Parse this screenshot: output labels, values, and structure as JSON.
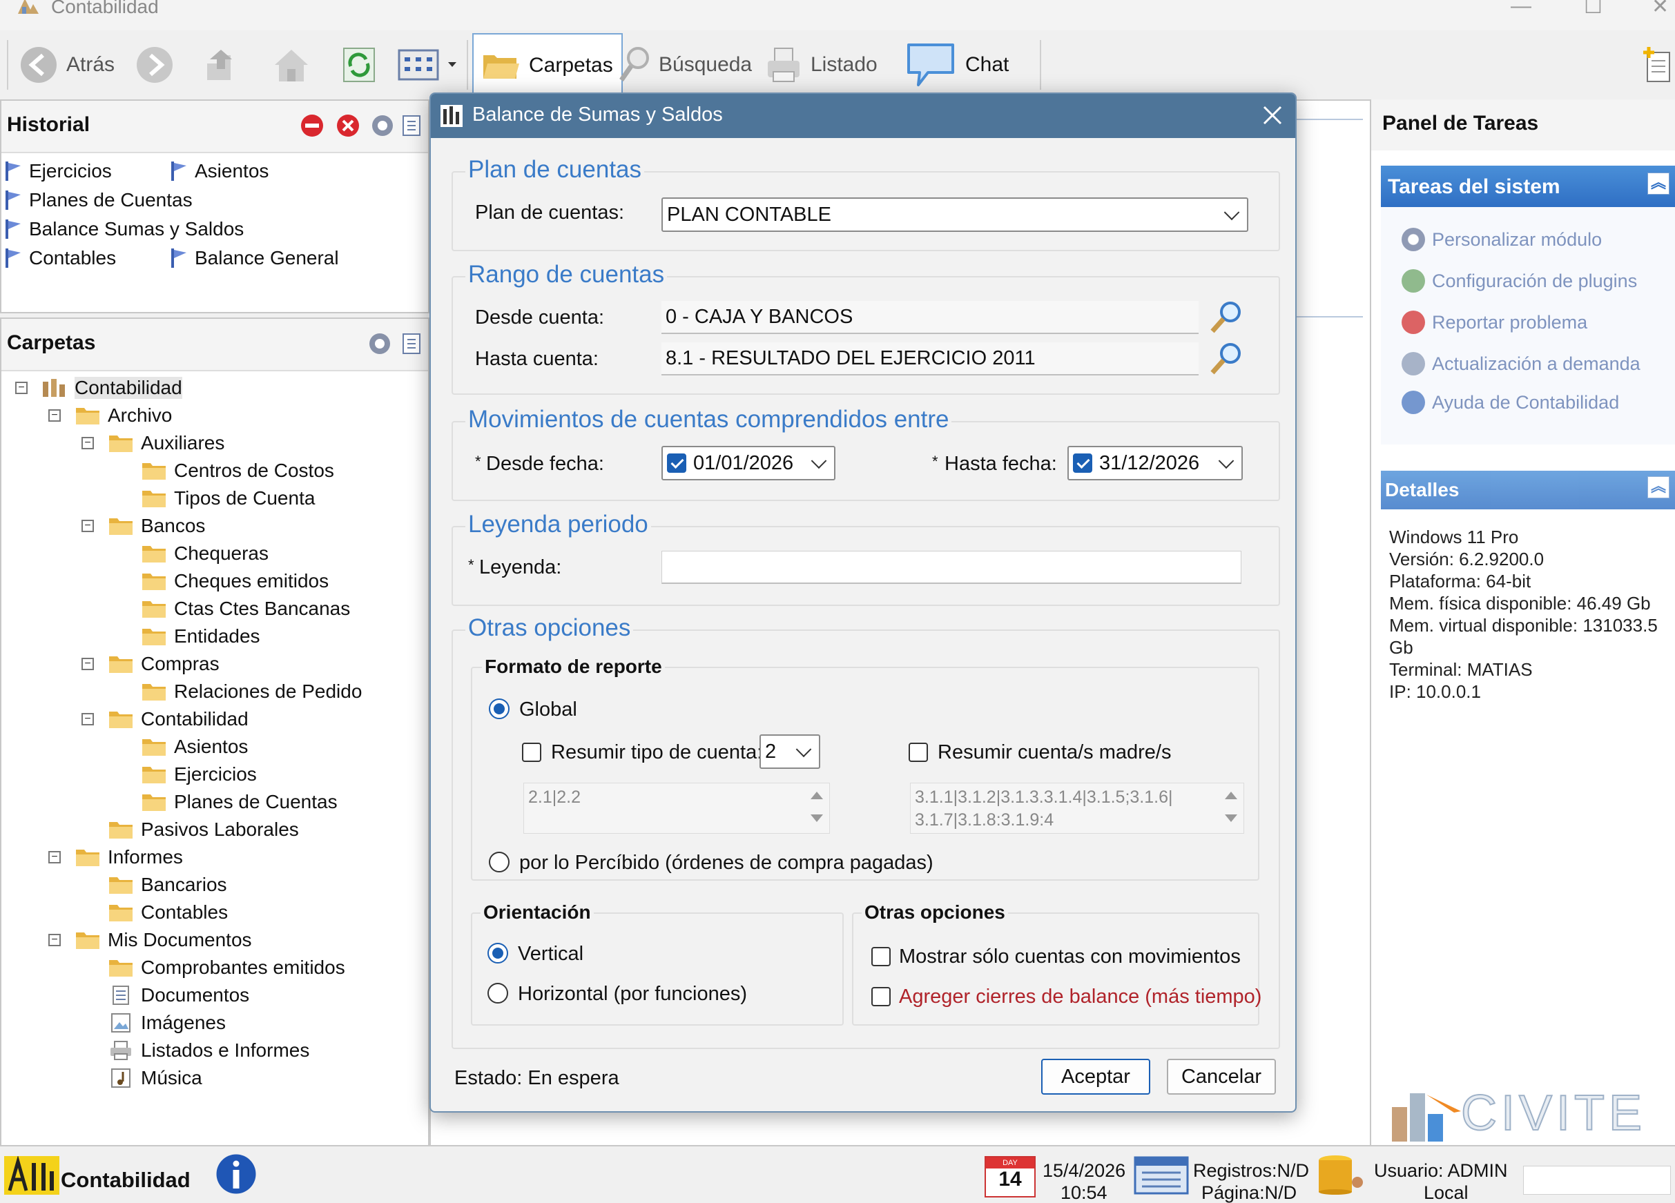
{
  "window": {
    "title": "Contabilidad",
    "minimize": "—",
    "maximize": "☐",
    "close": "✕"
  },
  "toolbar": {
    "back_label": "Atrás",
    "folders_label": "Carpetas",
    "search_label": "Búsqueda",
    "list_label": "Listado",
    "chat_label": "Chat"
  },
  "history": {
    "title": "Historial",
    "items": [
      "Ejercicios",
      "Asientos",
      "Planes de Cuentas",
      "Balance Sumas y Saldos",
      "Contables",
      "Balance General"
    ]
  },
  "folders": {
    "title": "Carpetas",
    "tree": [
      {
        "label": "Contabilidad"
      },
      {
        "label": "Archivo"
      },
      {
        "label": "Auxiliares"
      },
      {
        "label": "Centros de Costos"
      },
      {
        "label": "Tipos de Cuenta"
      },
      {
        "label": "Bancos"
      },
      {
        "label": "Chequeras"
      },
      {
        "label": "Cheques emitidos"
      },
      {
        "label": "Ctas Ctes Bancanas"
      },
      {
        "label": "Entidades"
      },
      {
        "label": "Compras"
      },
      {
        "label": "Relaciones de Pedido"
      },
      {
        "label": "Contabilidad"
      },
      {
        "label": "Asientos"
      },
      {
        "label": "Ejercicios"
      },
      {
        "label": "Planes de Cuentas"
      },
      {
        "label": "Pasivos Laborales"
      },
      {
        "label": "Informes"
      },
      {
        "label": "Bancarios"
      },
      {
        "label": "Contables"
      },
      {
        "label": "Mis Documentos"
      },
      {
        "label": "Comprobantes emitidos"
      },
      {
        "label": "Documentos"
      },
      {
        "label": "Imágenes"
      },
      {
        "label": "Listados e Informes"
      },
      {
        "label": "Música"
      }
    ]
  },
  "task_panel": {
    "title": "Panel de Tareas",
    "system_tasks_title": "Tareas del sistem",
    "tasks": [
      "Personalizar módulo",
      "Configuración de plugins",
      "Reportar problema",
      "Actualización a demanda",
      "Ayuda de Contabilidad"
    ],
    "details_title": "Detalles",
    "details": [
      "Windows 11 Pro",
      "Versión: 6.2.9200.0",
      "Plataforma: 64-bit",
      "Mem. física disponible: 46.49 Gb",
      "Mem. virtual disponible: 131033.5",
      "Gb",
      "Terminal: MATIAS",
      "IP: 10.0.0.1"
    ],
    "logo_text": "CIVITE"
  },
  "dialog": {
    "title": "Balance de Sumas y Saldos",
    "plan": {
      "section": "Plan de cuentas",
      "label": "Plan de cuentas:",
      "value": "PLAN CONTABLE"
    },
    "range": {
      "section": "Rango de cuentas",
      "from_label": "Desde cuenta:",
      "from_value": "0 - CAJA Y BANCOS",
      "to_label": "Hasta cuenta:",
      "to_value": "8.1 - RESULTADO DEL EJERCICIO 2011"
    },
    "movements": {
      "section": "Movimientos de cuentas comprendidos entre",
      "from_label": "Desde fecha:",
      "from_value": "01/01/2026",
      "to_label": "Hasta fecha:",
      "to_value": "31/12/2026",
      "required_mark": "*"
    },
    "legend": {
      "section": "Leyenda periodo",
      "label": "Leyenda:",
      "value": ""
    },
    "options": {
      "section": "Otras opciones",
      "format_title": "Formato de reporte",
      "global_label": "Global",
      "summarize_type_label": "Resumir tipo de cuenta:",
      "summarize_type_value": "2",
      "summarize_parent_label": "Resumir cuenta/s madre/s",
      "list_left": "2.1|2.2",
      "list_right_line1": "3.1.1|3.1.2|3.1.3.3.1.4|3.1.5;3.1.6|",
      "list_right_line2": "3.1.7|3.1.8:3.1.9:4",
      "perceived_label": "por lo Percíbido (órdenes de compra pagadas)",
      "orientation_title": "Orientación",
      "vertical_label": "Vertical",
      "horizontal_label": "Horizontal (por funciones)",
      "other_title": "Otras opciones",
      "only_movements_label": "Mostrar sólo cuentas con movimientos",
      "add_closings_label": "Agreger cierres de balance (más tiempo)"
    },
    "status": "Estado: En espera",
    "accept": "Aceptar",
    "cancel": "Cancelar"
  },
  "statusbar": {
    "app_name": "Contabilidad",
    "date": "15/4/2026",
    "time": "10:54",
    "records": "Registros:N/D",
    "page": "Página:N/D",
    "user": "Usuario: ADMIN",
    "location": "Local",
    "calendar_day": "14",
    "calendar_month": "DAY"
  }
}
